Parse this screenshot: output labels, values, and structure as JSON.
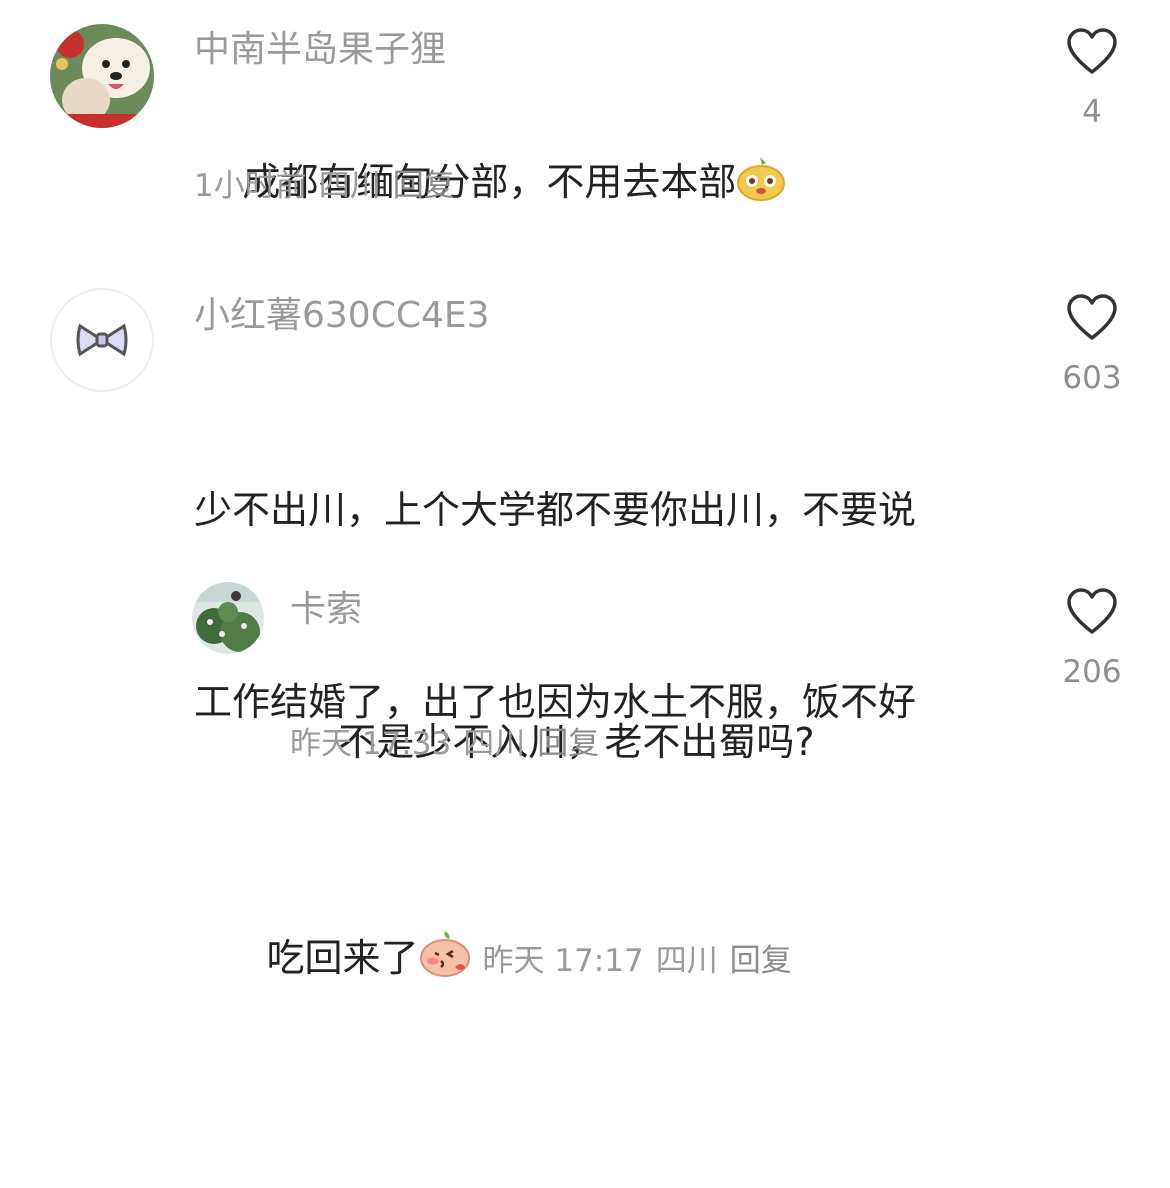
{
  "comments": [
    {
      "username": "中南半岛果子狸",
      "avatar_icon": "dog-cat-avatar",
      "text": "成都有缅甸分部，不用去本部",
      "emoji": "yellow-pear-emoji",
      "time": "1小时前",
      "location": "四川",
      "reply_label": "回复",
      "likes": "4"
    },
    {
      "username": "小红薯630CC4E3",
      "avatar_icon": "bow-avatar",
      "text_lines": [
        "少不出川，上个大学都不要你出川，不要说",
        "工作结婚了，出了也因为水土不服，饭不好",
        "吃回来了"
      ],
      "emoji": "blushing-peach-emoji",
      "time": "昨天 17:17",
      "location": "四川",
      "reply_label": "回复",
      "likes": "603"
    },
    {
      "username": "卡索",
      "avatar_icon": "garden-avatar",
      "text": "不是少不入川，老不出蜀吗?",
      "time": "昨天 17:33",
      "location": "四川",
      "reply_label": "回复",
      "likes": "206"
    }
  ]
}
